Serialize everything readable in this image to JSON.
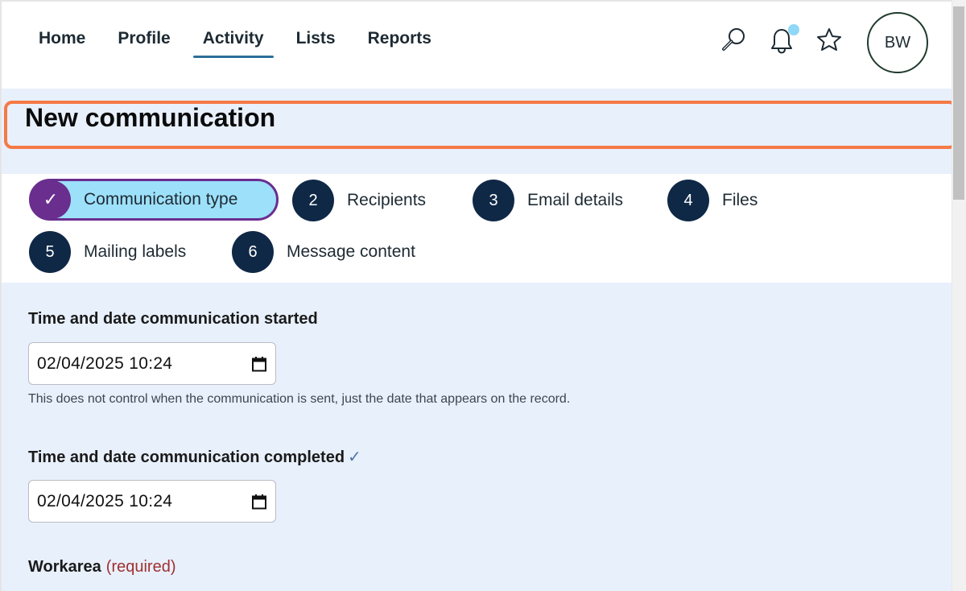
{
  "nav": {
    "links": [
      "Home",
      "Profile",
      "Activity",
      "Lists",
      "Reports"
    ],
    "active": "Activity",
    "icons": [
      "search-icon",
      "bell-icon",
      "star-icon"
    ],
    "avatar_initials": "BW",
    "notification_dot_color": "#8fd8f6"
  },
  "page": {
    "title": "New communication",
    "highlight_color": "#f57a46"
  },
  "stepper": {
    "active_step": {
      "icon": "✓",
      "label": "Communication type"
    },
    "steps": [
      {
        "number": "2",
        "label": "Recipients"
      },
      {
        "number": "3",
        "label": "Email details"
      },
      {
        "number": "4",
        "label": "Files"
      },
      {
        "number": "5",
        "label": "Mailing labels"
      },
      {
        "number": "6",
        "label": "Message content"
      }
    ]
  },
  "form": {
    "started": {
      "label": "Time and date communication started",
      "value": "02/04/2025 10:24",
      "hint": "This does not control when the communication is sent, just the date that appears on the record."
    },
    "completed": {
      "label": "Time and date communication completed",
      "check": "✓",
      "value": "02/04/2025 10:24"
    },
    "workarea": {
      "label": "Workarea",
      "required_text": "(required)"
    }
  },
  "colors": {
    "accent_purple": "#6a2e8f",
    "active_step_fill": "#9de0fa",
    "step_circle": "#0f2846",
    "form_background": "#e8f0fc"
  }
}
